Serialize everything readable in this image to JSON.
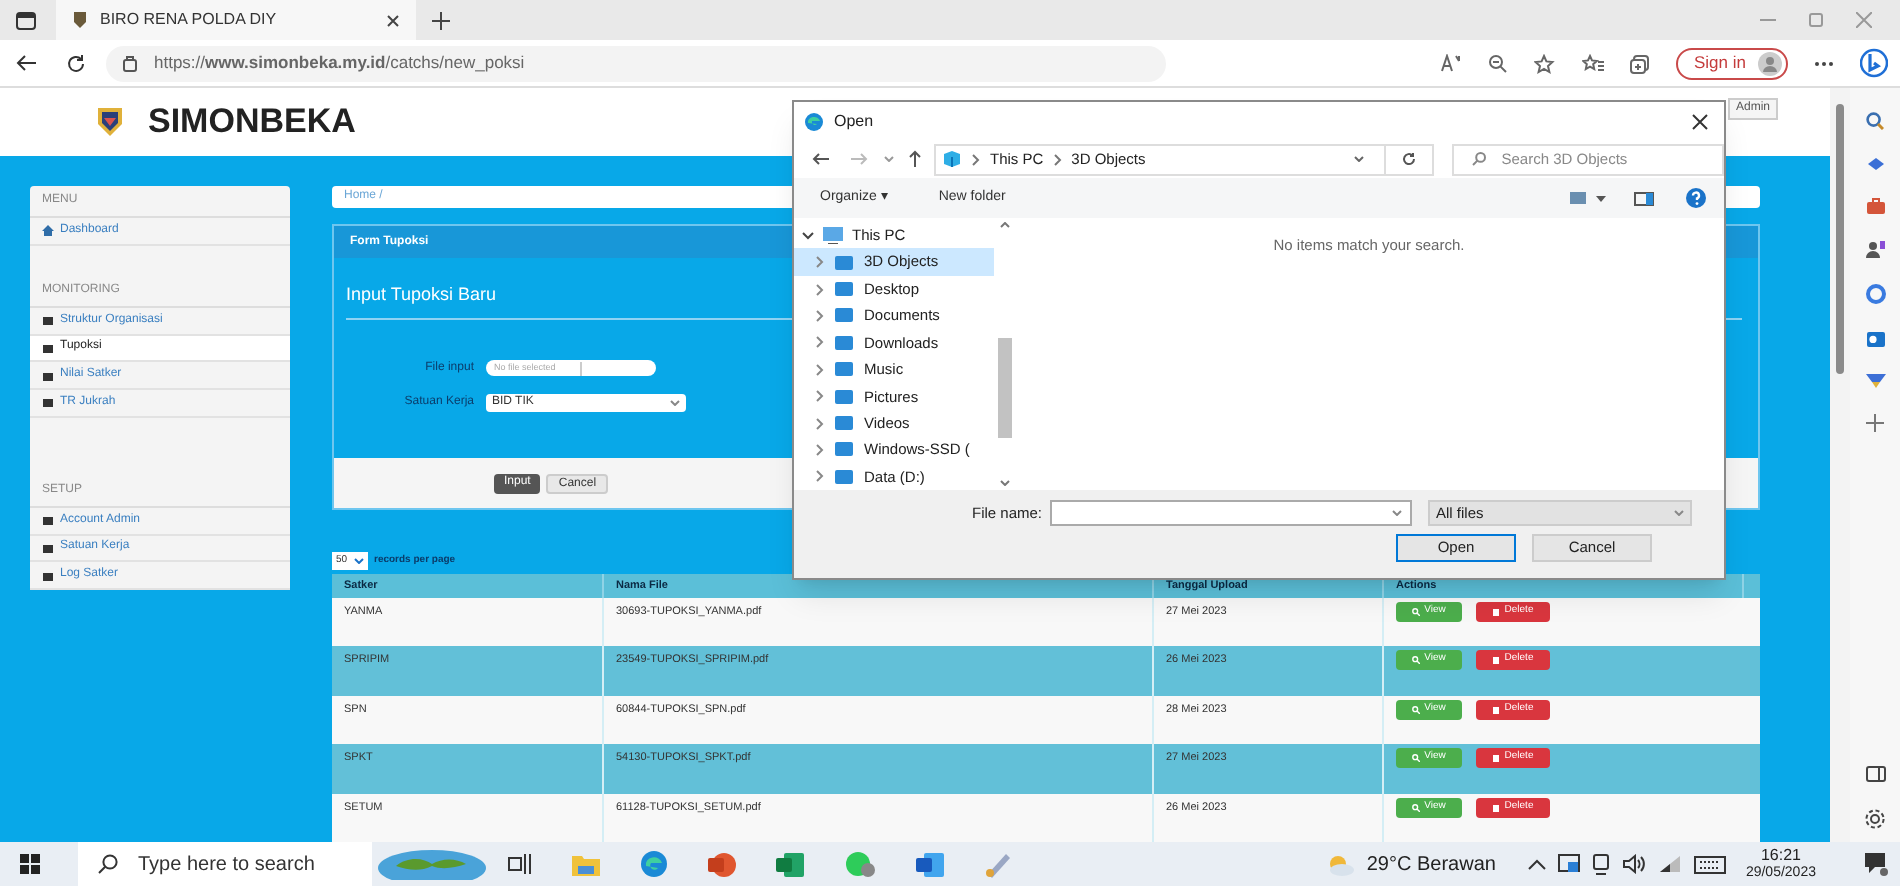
{
  "browser": {
    "tab_title": "BIRO RENA POLDA DIY",
    "url": "https://**www.simonbeka.my.id**/catchs/new_poksi",
    "sign_in": "Sign in"
  },
  "site": {
    "brand": "SIMONBEKA",
    "admin": "Admin",
    "sidebar": [
      {
        "heading": "MENU",
        "items": [
          {
            "label": "Dashboard",
            "selected": false
          }
        ]
      },
      {
        "heading": "MONITORING",
        "items": [
          {
            "label": "Struktur Organisasi",
            "selected": false
          },
          {
            "label": "Tupoksi",
            "selected": true
          },
          {
            "label": "Nilai Satker",
            "selected": false
          },
          {
            "label": "TR Jukrah",
            "selected": false
          }
        ]
      },
      {
        "heading": "SETUP",
        "items": [
          {
            "label": "Account Admin",
            "selected": false
          },
          {
            "label": "Satuan Kerja",
            "selected": false
          },
          {
            "label": "Log Satker",
            "selected": false
          }
        ]
      }
    ],
    "breadcrumb": "Home /",
    "form": {
      "panel_title": "Form Tupoksi",
      "heading": "Input Tupoksi Baru",
      "file_label": "File input",
      "file_placeholder": "No file selected",
      "unit_label": "Satuan Kerja",
      "unit_value": "BID TIK",
      "submit": "Input",
      "cancel": "Cancel"
    },
    "records": {
      "value": "50",
      "label": "records per page"
    },
    "table": {
      "columns": [
        "Satker",
        "Nama File",
        "Tanggal Upload",
        "Actions"
      ],
      "rows": [
        {
          "cells": [
            "YANMA",
            "30693-TUPOKSI_YANMA.pdf",
            "27 Mei 2023"
          ],
          "actions": [
            "View",
            "Delete"
          ]
        },
        {
          "cells": [
            "SPRIPIM",
            "23549-TUPOKSI_SPRIPIM.pdf",
            "26 Mei 2023"
          ],
          "actions": [
            "View",
            "Delete"
          ]
        },
        {
          "cells": [
            "SPN",
            "60844-TUPOKSI_SPN.pdf",
            "28 Mei 2023"
          ],
          "actions": [
            "View",
            "Delete"
          ]
        },
        {
          "cells": [
            "SPKT",
            "54130-TUPOKSI_SPKT.pdf",
            "27 Mei 2023"
          ],
          "actions": [
            "View",
            "Delete"
          ]
        },
        {
          "cells": [
            "SETUM",
            "61128-TUPOKSI_SETUM.pdf",
            "26 Mei 2023"
          ],
          "actions": [
            "View",
            "Delete"
          ]
        }
      ]
    }
  },
  "dialog": {
    "title": "Open",
    "path": [
      "This PC",
      "3D Objects"
    ],
    "search_placeholder": "Search 3D Objects",
    "organize": "Organize ▾",
    "new_folder": "New folder",
    "tree": [
      {
        "label": "This PC",
        "expanded": true,
        "selected": false,
        "children": [
          {
            "label": "3D Objects",
            "selected": true
          },
          {
            "label": "Desktop",
            "selected": false
          },
          {
            "label": "Documents",
            "selected": false
          },
          {
            "label": "Downloads",
            "selected": false
          },
          {
            "label": "Music",
            "selected": false
          },
          {
            "label": "Pictures",
            "selected": false
          },
          {
            "label": "Videos",
            "selected": false
          },
          {
            "label": "Windows-SSD (",
            "selected": false
          },
          {
            "label": "Data (D:)",
            "selected": false
          }
        ]
      }
    ],
    "empty_message": "No items match your search.",
    "file_name_label": "File name:",
    "file_type": "All files",
    "open": "Open",
    "cancel": "Cancel"
  },
  "taskbar": {
    "search_placeholder": "Type here to search",
    "weather": "29°C Berawan",
    "time": "16:21",
    "date": "29/05/2023"
  }
}
